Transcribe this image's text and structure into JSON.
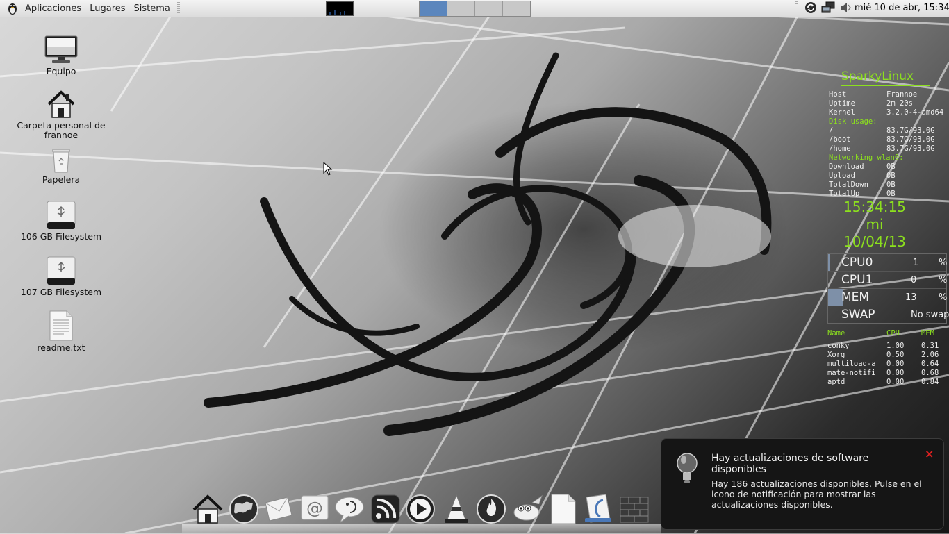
{
  "top_panel": {
    "menus": [
      "Aplicaciones",
      "Lugares",
      "Sistema"
    ],
    "clock": "mié 10 de abr, 15:34",
    "workspaces_count": 4,
    "active_workspace": 1
  },
  "desktop_icons": [
    {
      "label": "Equipo",
      "icon": "computer-icon"
    },
    {
      "label": "Carpeta personal de frannoe",
      "icon": "home-folder-icon"
    },
    {
      "label": "Papelera",
      "icon": "trash-icon"
    },
    {
      "label": "106 GB Filesystem",
      "icon": "drive-icon"
    },
    {
      "label": "107 GB Filesystem",
      "icon": "drive-icon"
    },
    {
      "label": "readme.txt",
      "icon": "text-file-icon"
    }
  ],
  "conky": {
    "title": "SparkyLinux",
    "host_k": "Host",
    "host_v": "Frannoe",
    "uptime_k": "Uptime",
    "uptime_v": "2m 20s",
    "kernel_k": "Kernel",
    "kernel_v": "3.2.0-4-amd64",
    "disk_title": "Disk usage:",
    "disk": [
      {
        "mount": "/",
        "usage": "83.7G/93.0G"
      },
      {
        "mount": "/boot",
        "usage": "83.7G/93.0G"
      },
      {
        "mount": "/home",
        "usage": "83.7G/93.0G"
      }
    ],
    "net_title": "Networking wlan0:",
    "net": [
      {
        "k": "Download",
        "v": "0B"
      },
      {
        "k": "Upload",
        "v": "0B"
      },
      {
        "k": "TotalDown",
        "v": "0B"
      },
      {
        "k": "TotalUp",
        "v": "0B"
      }
    ],
    "time": "15:34:15",
    "day": "mi",
    "date": "10/04/13",
    "meters": [
      {
        "label": "CPU0",
        "value": "1",
        "unit": "%",
        "fill": 0.01
      },
      {
        "label": "CPU1",
        "value": "0",
        "unit": "%",
        "fill": 0.0
      },
      {
        "label": "MEM",
        "value": "13",
        "unit": "%",
        "fill": 0.13
      },
      {
        "label": "SWAP",
        "value": "No swap",
        "unit": "",
        "fill": 0.0
      }
    ],
    "proc_headers": [
      "Name",
      "CPU",
      "MEM"
    ],
    "procs": [
      {
        "name": "conky",
        "cpu": "1.00",
        "mem": "0.31"
      },
      {
        "name": "Xorg",
        "cpu": "0.50",
        "mem": "2.06"
      },
      {
        "name": "multiload-a",
        "cpu": "0.00",
        "mem": "0.64"
      },
      {
        "name": "mate-notifi",
        "cpu": "0.00",
        "mem": "0.68"
      },
      {
        "name": "aptd",
        "cpu": "0.00",
        "mem": "0.84"
      }
    ]
  },
  "notification": {
    "title": "Hay actualizaciones de software disponibles",
    "body": "Hay 186 actualizaciones disponibles. Pulse en el icono de notificación para mostrar las actualizaciones disponibles.",
    "close": "×"
  },
  "dock_items": [
    "home-icon",
    "web-browser-icon",
    "mail-icon",
    "email-client-icon",
    "chat-icon",
    "rss-icon",
    "media-player-icon",
    "vlc-icon",
    "burner-icon",
    "gimp-icon",
    "document-icon",
    "office-icon",
    "firewall-icon"
  ],
  "colors": {
    "accent": "#8ce01e",
    "workspace_active": "#5b86bd",
    "close": "#e02020"
  }
}
